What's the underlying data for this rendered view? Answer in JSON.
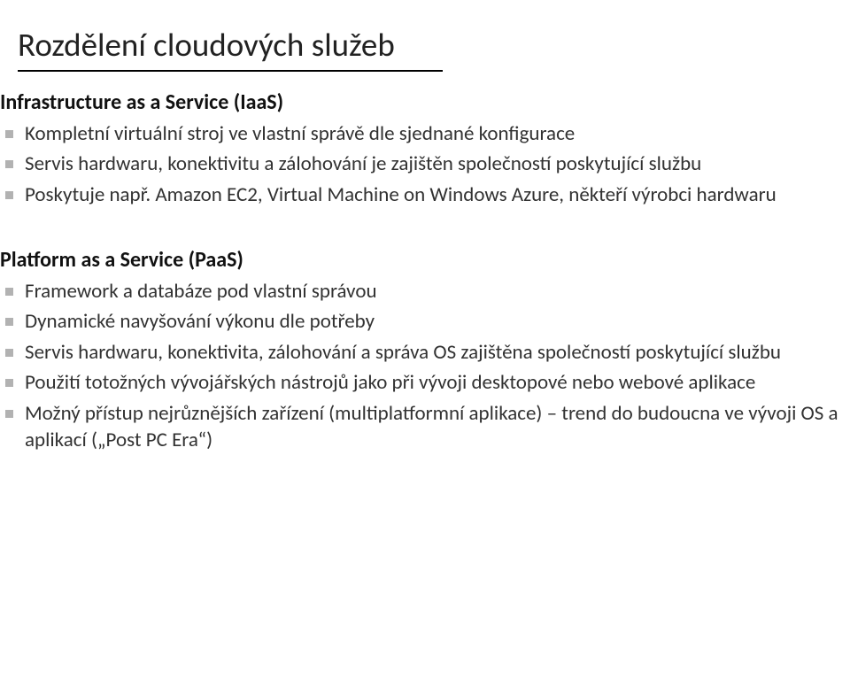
{
  "title": "Rozdělení cloudových služeb",
  "sections": [
    {
      "header": "Infrastructure as a Service (IaaS)",
      "items": [
        "Kompletní virtuální stroj ve vlastní správě dle sjednané konfigurace",
        "Servis hardwaru, konektivitu a zálohování je zajištěn společností poskytující službu",
        "Poskytuje např. Amazon EC2, Virtual Machine on Windows Azure, někteří výrobci hardwaru"
      ]
    },
    {
      "header": "Platform as a Service (PaaS)",
      "items": [
        "Framework a databáze pod vlastní správou",
        "Dynamické navyšování výkonu dle potřeby",
        "Servis hardwaru, konektivita, zálohování a správa OS zajištěna společností poskytující službu",
        "Použití totožných vývojářských nástrojů jako při vývoji desktopové nebo webové aplikace",
        "Možný přístup nejrůznějších zařízení (multiplatformní aplikace) – trend do budoucna ve vývoji OS a aplikací („Post PC Era“)"
      ]
    }
  ]
}
